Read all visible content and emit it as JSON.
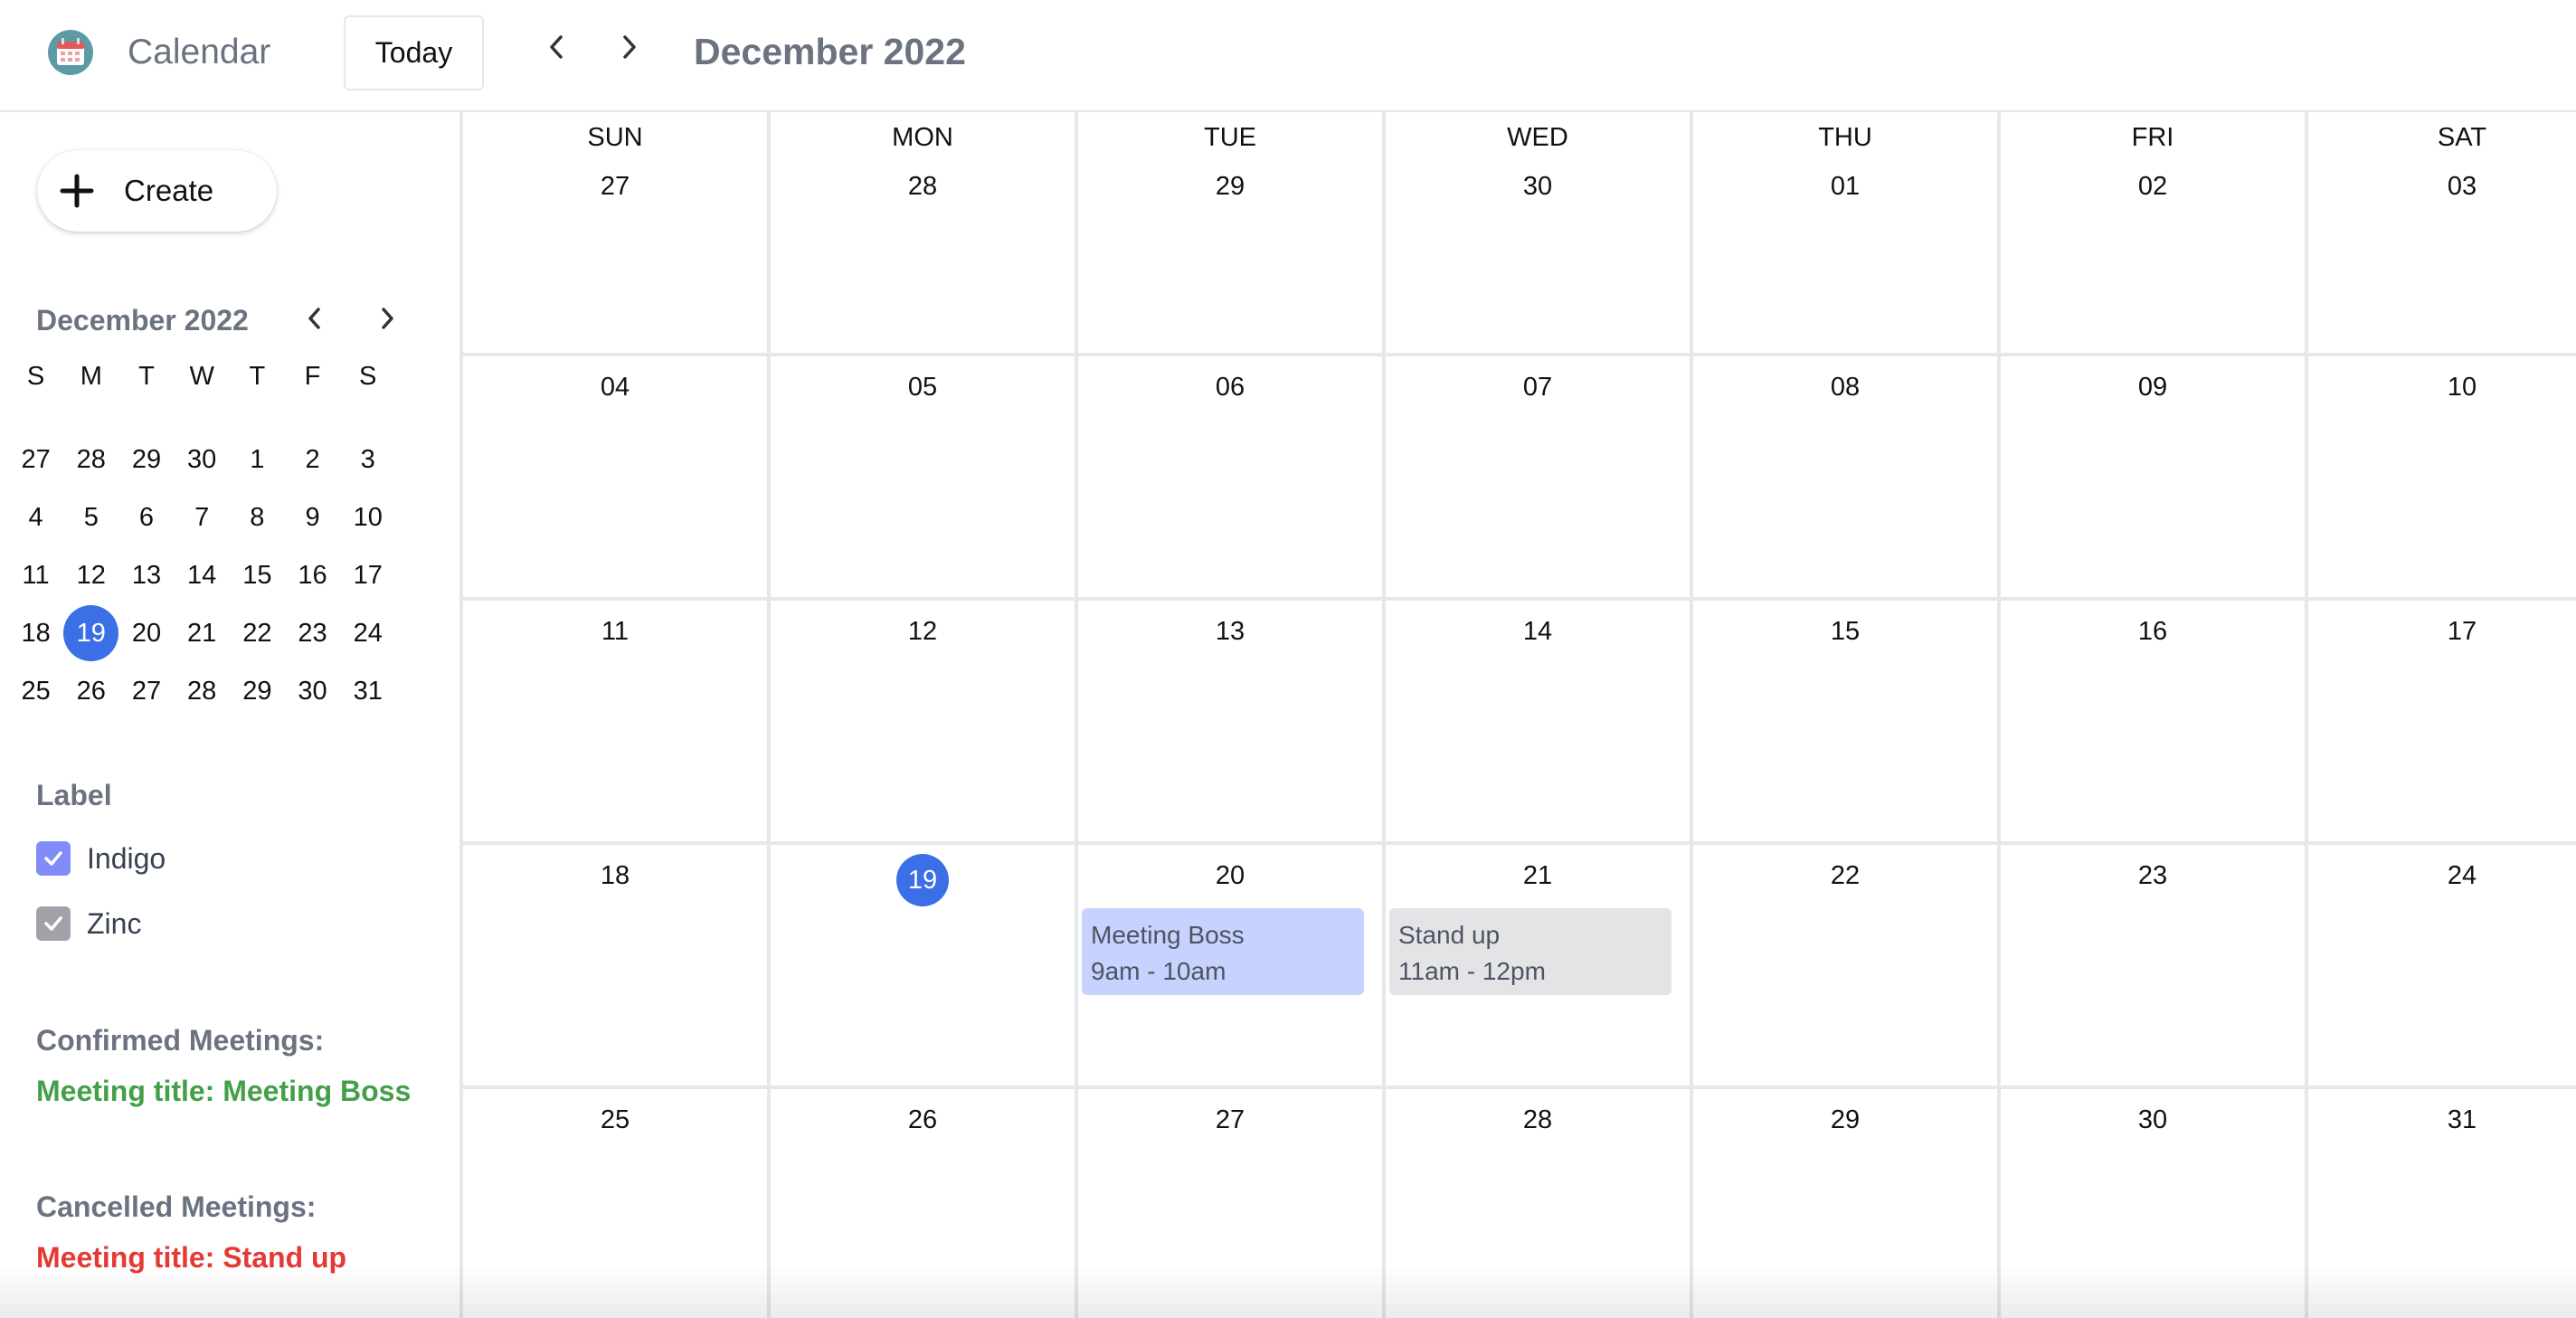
{
  "header": {
    "app_title": "Calendar",
    "today_label": "Today",
    "month_title": "December 2022",
    "logo_icon": "calendar-logo-icon",
    "prev_icon": "chevron-left-icon",
    "next_icon": "chevron-right-icon"
  },
  "sidebar": {
    "create_label": "Create",
    "mini_calendar": {
      "title": "December 2022",
      "weekday_headers": [
        "S",
        "M",
        "T",
        "W",
        "T",
        "F",
        "S"
      ],
      "weeks": [
        [
          "27",
          "28",
          "29",
          "30",
          "1",
          "2",
          "3"
        ],
        [
          "4",
          "5",
          "6",
          "7",
          "8",
          "9",
          "10"
        ],
        [
          "11",
          "12",
          "13",
          "14",
          "15",
          "16",
          "17"
        ],
        [
          "18",
          "19",
          "20",
          "21",
          "22",
          "23",
          "24"
        ],
        [
          "25",
          "26",
          "27",
          "28",
          "29",
          "30",
          "31"
        ]
      ],
      "selected": "19"
    },
    "label_title": "Label",
    "labels": [
      {
        "name": "Indigo",
        "checked": true,
        "color": "#818cf8"
      },
      {
        "name": "Zinc",
        "checked": true,
        "color": "#a1a1aa"
      }
    ],
    "confirmed_title": "Confirmed Meetings:",
    "confirmed_value": "Meeting title: Meeting Boss",
    "confirmed_color": "#43a047",
    "cancelled_title": "Cancelled Meetings:",
    "cancelled_value": "Meeting title: Stand up",
    "cancelled_color": "#e53935"
  },
  "calendar": {
    "weekdays": [
      "SUN",
      "MON",
      "TUE",
      "WED",
      "THU",
      "FRI",
      "SAT"
    ],
    "weeks": [
      [
        "27",
        "28",
        "29",
        "30",
        "01",
        "02",
        "03"
      ],
      [
        "04",
        "05",
        "06",
        "07",
        "08",
        "09",
        "10"
      ],
      [
        "11",
        "12",
        "13",
        "14",
        "15",
        "16",
        "17"
      ],
      [
        "18",
        "19",
        "20",
        "21",
        "22",
        "23",
        "24"
      ],
      [
        "25",
        "26",
        "27",
        "28",
        "29",
        "30",
        "31"
      ]
    ],
    "today": "19",
    "today_color": "#3b6fe6",
    "events": {
      "meeting_boss": {
        "title": "Meeting Boss",
        "time": "9am - 10am",
        "color": "#c7d2fe"
      },
      "stand_up": {
        "title": "Stand up",
        "time": "11am - 12pm",
        "color": "#e4e4e7"
      }
    }
  }
}
